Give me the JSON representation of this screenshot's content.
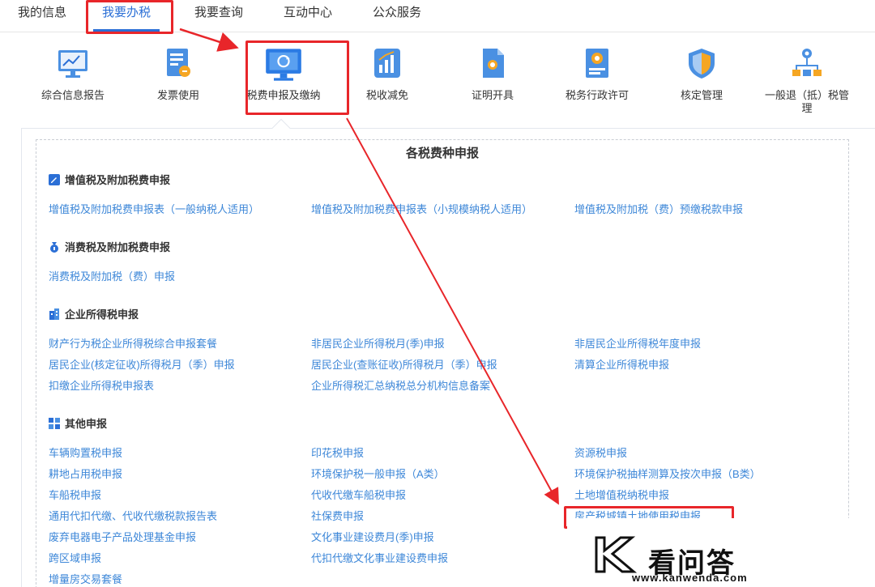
{
  "nav": {
    "tabs": [
      "我的信息",
      "我要办税",
      "我要查询",
      "互动中心",
      "公众服务"
    ]
  },
  "services": [
    {
      "label": "综合信息报告",
      "icon": "monitor-chart-icon"
    },
    {
      "label": "发票使用",
      "icon": "invoice-icon"
    },
    {
      "label": "税费申报及缴纳",
      "icon": "monitor-refresh-icon"
    },
    {
      "label": "税收减免",
      "icon": "bar-chart-icon"
    },
    {
      "label": "证明开具",
      "icon": "certificate-doc-icon"
    },
    {
      "label": "税务行政许可",
      "icon": "medal-doc-icon"
    },
    {
      "label": "核定管理",
      "icon": "shield-icon"
    },
    {
      "label": "一般退（抵）税管理",
      "icon": "org-tree-icon"
    }
  ],
  "panel": {
    "title": "各税费种申报",
    "sections": [
      {
        "heading": "增值税及附加税费申报",
        "links": [
          "增值税及附加税费申报表（一般纳税人适用）",
          "增值税及附加税费申报表（小规模纳税人适用）",
          "增值税及附加税（费）预缴税款申报"
        ]
      },
      {
        "heading": "消费税及附加税费申报",
        "links": [
          "消费税及附加税（费）申报"
        ]
      },
      {
        "heading": "企业所得税申报",
        "links": [
          "财产行为税企业所得税综合申报套餐",
          "非居民企业所得税月(季)申报",
          "非居民企业所得税年度申报",
          "居民企业(核定征收)所得税月（季）申报",
          "居民企业(查账征收)所得税月（季）申报",
          "清算企业所得税申报",
          "扣缴企业所得税申报表",
          "企业所得税汇总纳税总分机构信息备案"
        ]
      },
      {
        "heading": "其他申报",
        "links": [
          "车辆购置税申报",
          "印花税申报",
          "资源税申报",
          "耕地占用税申报",
          "环境保护税一般申报（A类）",
          "环境保护税抽样测算及按次申报（B类）",
          "车船税申报",
          "代收代缴车船税申报",
          "土地增值税纳税申报",
          "通用代扣代缴、代收代缴税款报告表",
          "社保费申报",
          "房产税城镇土地使用税申报",
          "废弃电器电子产品处理基金申报",
          "文化事业建设费月(季)申报",
          "跨区域申报",
          "代扣代缴文化事业建设费申报",
          "增量房交易套餐"
        ]
      }
    ]
  },
  "watermark": {
    "brand": "看问答",
    "url": "www.kanwenda.com"
  },
  "colors": {
    "accent": "#2b6fd6",
    "link": "#3d87d8",
    "highlight": "#e8262a"
  }
}
